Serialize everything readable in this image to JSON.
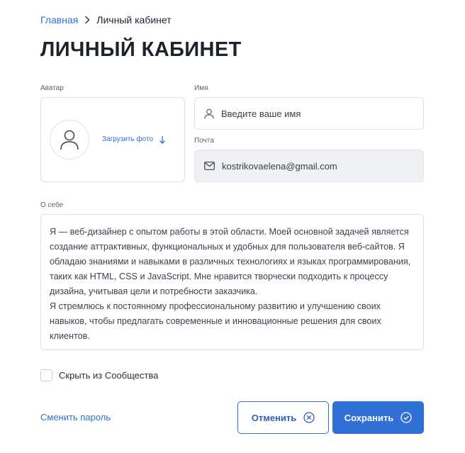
{
  "breadcrumb": {
    "home": "Главная",
    "current": "Личный кабинет"
  },
  "page_title": "ЛИЧНЫЙ КАБИНЕТ",
  "avatar": {
    "label": "Аватар",
    "upload_label": "Загрузить фото"
  },
  "name_field": {
    "label": "Имя",
    "placeholder": "Введите ваше имя",
    "value": ""
  },
  "email_field": {
    "label": "Почта",
    "value": "kostrikovaelena@gmail.com"
  },
  "about": {
    "label": "О себе",
    "text": "Я — веб-дизайнер с опытом работы в этой области. Моей основной задачей является создание аттрактивных, функциональных и удобных для пользователя веб-сайтов. Я обладаю знаниями и навыками в различных технологиях и языках программирования, таких как HTML, CSS и JavaScript. Мне нравится творчески подходить к процессу дизайна, учитывая цели и потребности заказчика.\nЯ стремлюсь к постоянному профессиональному развитию и улучшению своих навыков, чтобы предлагать современные и инновационные решения для своих клиентов."
  },
  "hide_from_community": {
    "label": "Скрыть из Сообщества",
    "checked": false
  },
  "actions": {
    "change_password": "Сменить пароль",
    "cancel": "Отменить",
    "save": "Сохранить"
  },
  "icons": {
    "breadcrumb_separator": "chevron-right-icon",
    "avatar": "user-icon",
    "upload": "arrow-down-icon",
    "name": "user-icon",
    "email": "mail-icon",
    "cancel": "close-circle-icon",
    "save": "check-circle-icon"
  },
  "colors": {
    "accent": "#2f6fd6",
    "border": "#dde1e7",
    "disabled_bg": "#eef0f3",
    "text": "#1f2430"
  }
}
